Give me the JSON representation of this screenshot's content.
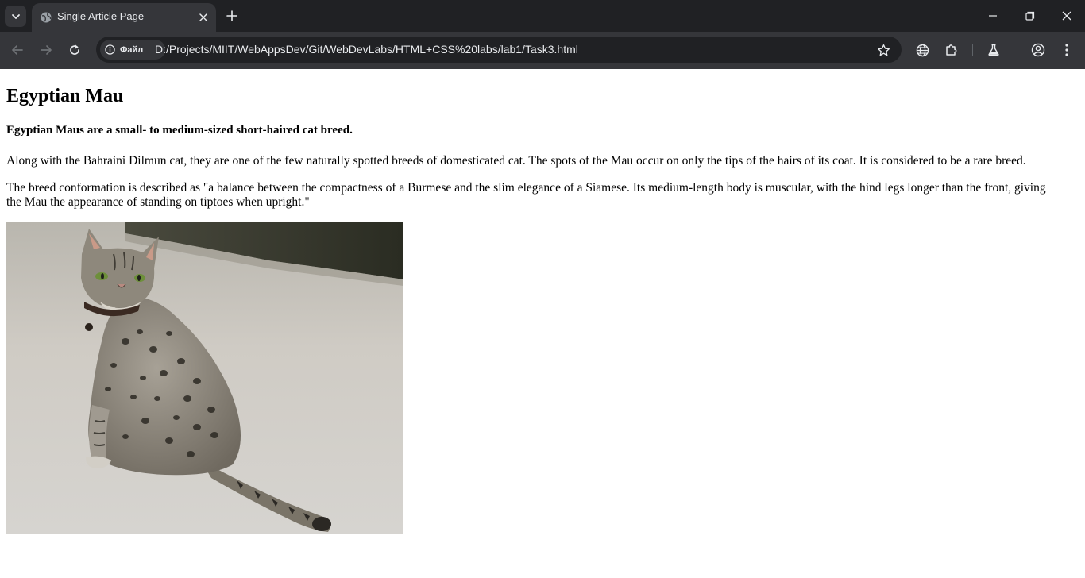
{
  "browser": {
    "tab": {
      "title": "Single Article Page"
    },
    "address_bar": {
      "site_chip_label": "Файл",
      "url": "D:/Projects/MIIT/WebAppsDev/Git/WebDevLabs/HTML+CSS%20labs/lab1/Task3.html"
    },
    "icons": [
      "tab-search-icon",
      "globe-icon",
      "close-icon",
      "plus-icon",
      "minimize-icon",
      "restore-icon",
      "back-icon",
      "forward-icon",
      "reload-icon",
      "info-icon",
      "star-icon",
      "translate-icon",
      "extensions-icon",
      "labs-icon",
      "profile-icon",
      "menu-icon"
    ],
    "colors": {
      "titlebar": "#202124",
      "toolbar": "#35363a",
      "omnibox": "#202124",
      "text": "#e8eaed"
    }
  },
  "article": {
    "title": "Egyptian Mau",
    "subtitle": "Egyptian Maus are a small- to medium-sized short-haired cat breed.",
    "paragraphs": [
      "Along with the Bahraini Dilmun cat, they are one of the few naturally spotted breeds of domesticated cat. The spots of the Mau occur on only the tips of the hairs of its coat. It is considered to be a rare breed.",
      "The breed conformation is described as \"a balance between the compactness of a Burmese and the slim elegance of a Siamese. Its medium-length body is muscular, with the hind legs longer than the front, giving the Mau the appearance of standing on tiptoes when upright.\""
    ],
    "image_subject": "spotted-cat-photo"
  }
}
